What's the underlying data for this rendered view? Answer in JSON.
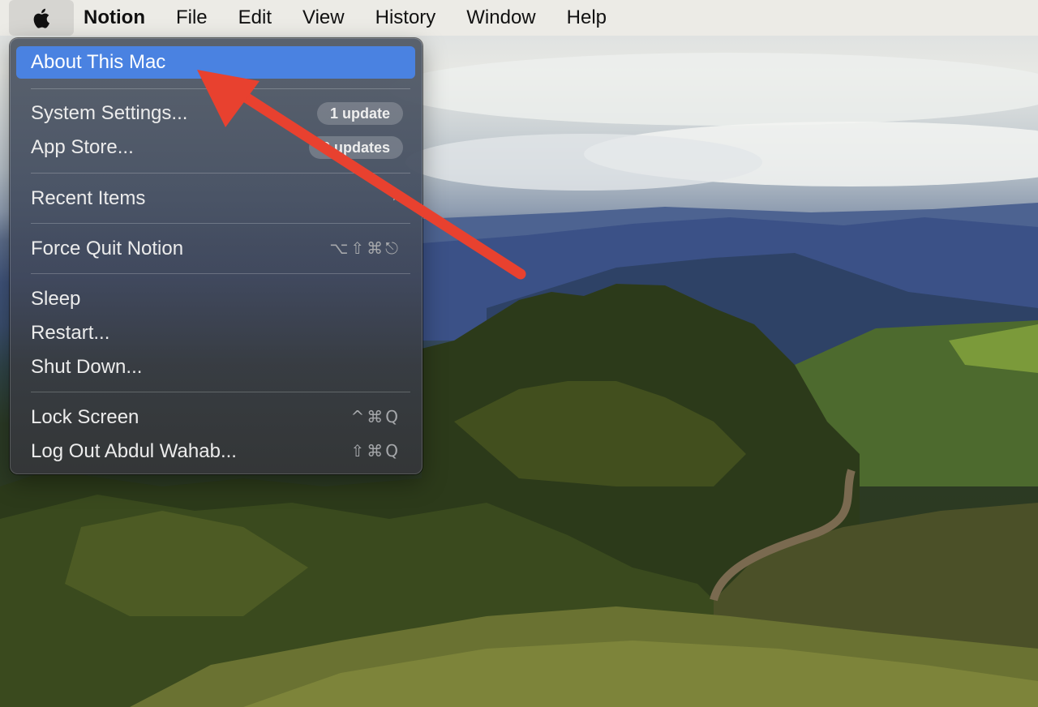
{
  "menubar": {
    "apple_icon": "apple-logo-icon",
    "items": [
      "Notion",
      "File",
      "Edit",
      "View",
      "History",
      "Window",
      "Help"
    ]
  },
  "apple_menu": {
    "items": {
      "about": "About This Mac",
      "system_settings": "System Settings...",
      "system_settings_badge": "1 update",
      "app_store": "App Store...",
      "app_store_badge": "2 updates",
      "recent_items": "Recent Items",
      "recent_items_indicator": "›",
      "force_quit": "Force Quit Notion",
      "force_quit_shortcut": "⌥⇧⌘⎋",
      "sleep": "Sleep",
      "restart": "Restart...",
      "shut_down": "Shut Down...",
      "lock_screen": "Lock Screen",
      "lock_screen_shortcut": "^⌘Q",
      "log_out": "Log Out Abdul Wahab...",
      "log_out_shortcut": "⇧⌘Q"
    },
    "highlight_color": "#4a82e1"
  },
  "annotation": {
    "arrow_color": "#e8412f"
  }
}
